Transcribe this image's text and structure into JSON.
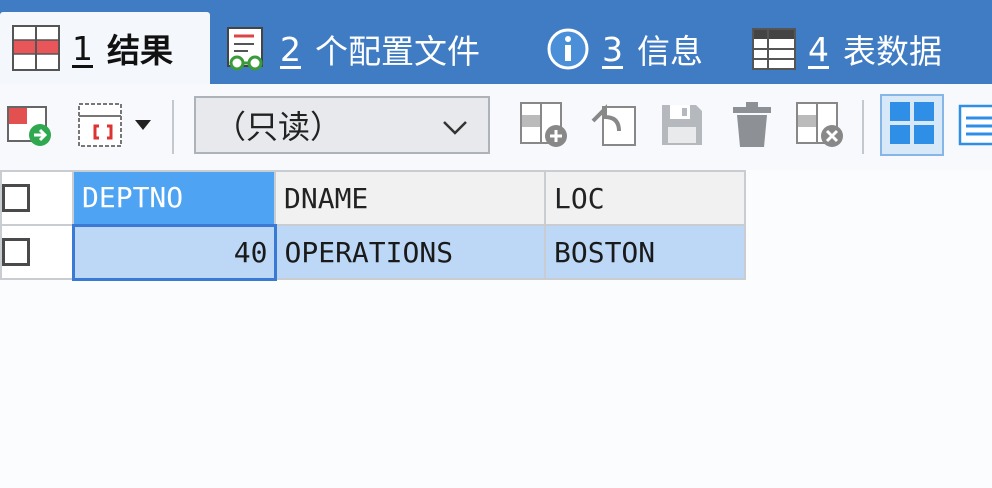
{
  "tabs": [
    {
      "num": "1",
      "label": "结果",
      "icon": "result-grid-icon",
      "active": true
    },
    {
      "num": "2",
      "label": "个配置文件",
      "icon": "profile-glasses-icon",
      "active": false
    },
    {
      "num": "3",
      "label": "信息",
      "icon": "info-icon",
      "active": false
    },
    {
      "num": "4",
      "label": "表数据",
      "icon": "table-data-icon",
      "active": false
    }
  ],
  "toolbar": {
    "mode_select": {
      "value": "（只读）",
      "options": [
        "（只读）"
      ]
    },
    "icons": [
      "export-record-icon",
      "filter-dropdown-icon",
      "add-row-icon",
      "undo-icon",
      "save-icon",
      "delete-icon",
      "discard-icon",
      "grid-view-icon",
      "form-view-icon"
    ]
  },
  "grid": {
    "columns": [
      "DEPTNO",
      "DNAME",
      "LOC"
    ],
    "rows": [
      {
        "DEPTNO": "40",
        "DNAME": "OPERATIONS",
        "LOC": "BOSTON"
      }
    ]
  },
  "colors": {
    "tab_bar": "#3f7cc4",
    "header_sorted": "#4fa3f3",
    "row_selected": "#bcd8f6"
  }
}
